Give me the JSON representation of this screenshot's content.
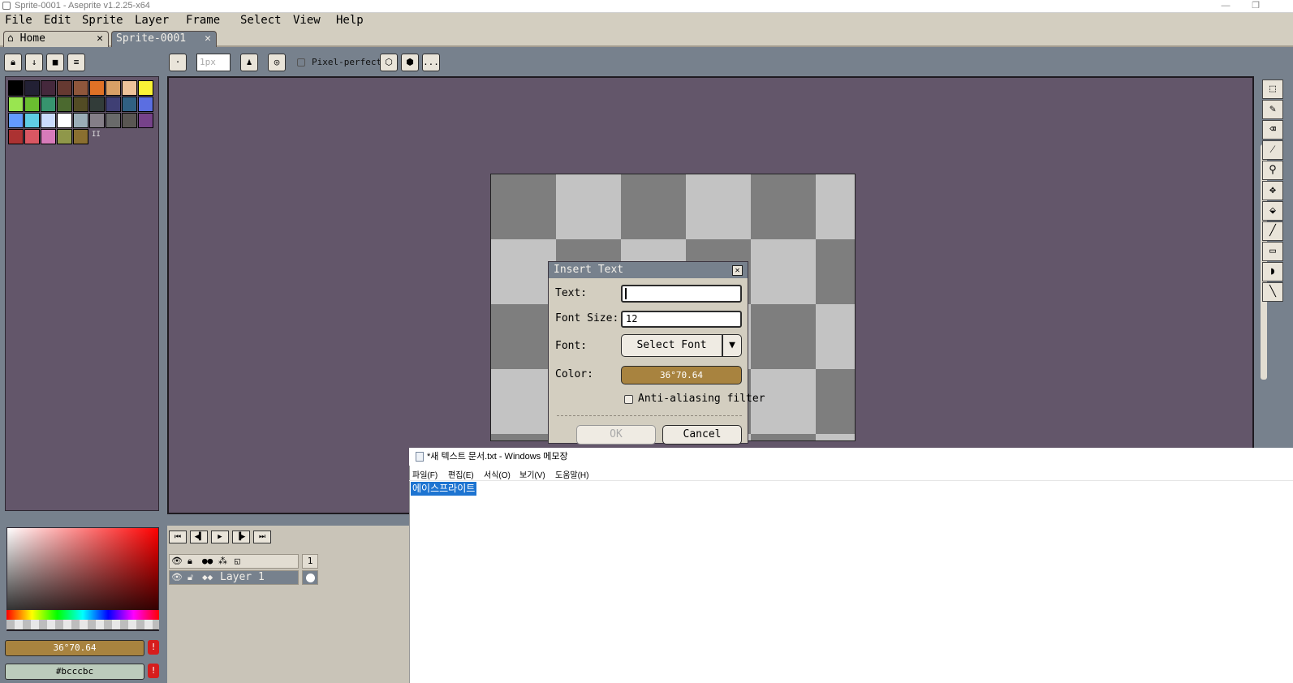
{
  "window": {
    "title": "Sprite-0001 - Aseprite v1.2.25-x64"
  },
  "menu": [
    "File",
    "Edit",
    "Sprite",
    "Layer",
    "Frame",
    "Select",
    "View",
    "Help"
  ],
  "tabs": {
    "home": "Home",
    "sprite": "Sprite-0001",
    "close": "✕"
  },
  "toolbar": {
    "brush_size": "1px",
    "pixel_perfect": "Pixel-perfect",
    "more": "..."
  },
  "palette": {
    "colors": [
      "#000000",
      "#222034",
      "#45283c",
      "#663931",
      "#8f563b",
      "#df7126",
      "#d9a066",
      "#eec39a",
      "#fbf236",
      "#99e550",
      "#6abe30",
      "#37946e",
      "#4b692f",
      "#524b24",
      "#323c39",
      "#3f3f74",
      "#306082",
      "#5b6ee1",
      "#639bff",
      "#5fcde4",
      "#cbdbfc",
      "#ffffff",
      "#9badb7",
      "#847e87",
      "#696a6a",
      "#595652",
      "#76428a",
      "#ac3232",
      "#d95763",
      "#d77bba",
      "#8f974a",
      "#8a6f30"
    ],
    "more_marker": "II"
  },
  "dialog": {
    "title": "Insert Text",
    "text_label": "Text:",
    "text_value": "",
    "font_size_label": "Font Size:",
    "font_size_value": "12",
    "font_label": "Font:",
    "font_button": "Select Font",
    "color_label": "Color:",
    "color_value": "36°70.64",
    "color_hex": "#a8833f",
    "aa_label": "Anti-aliasing filter",
    "ok": "OK",
    "cancel": "Cancel"
  },
  "colors": {
    "fg_label": "36°70.64",
    "fg_color": "#a8833f",
    "bg_label": "#bcccbc",
    "bg_color": "#bcccbc",
    "warn": "!"
  },
  "timeline": {
    "frame_number": "1",
    "layer_name": "Layer 1"
  },
  "notepad": {
    "title": "*새 텍스트 문서.txt - Windows 메모장",
    "menu": [
      "파일(F)",
      "편집(E)",
      "서식(O)",
      "보기(V)",
      "도움말(H)"
    ],
    "content": "에이스프라이트"
  }
}
